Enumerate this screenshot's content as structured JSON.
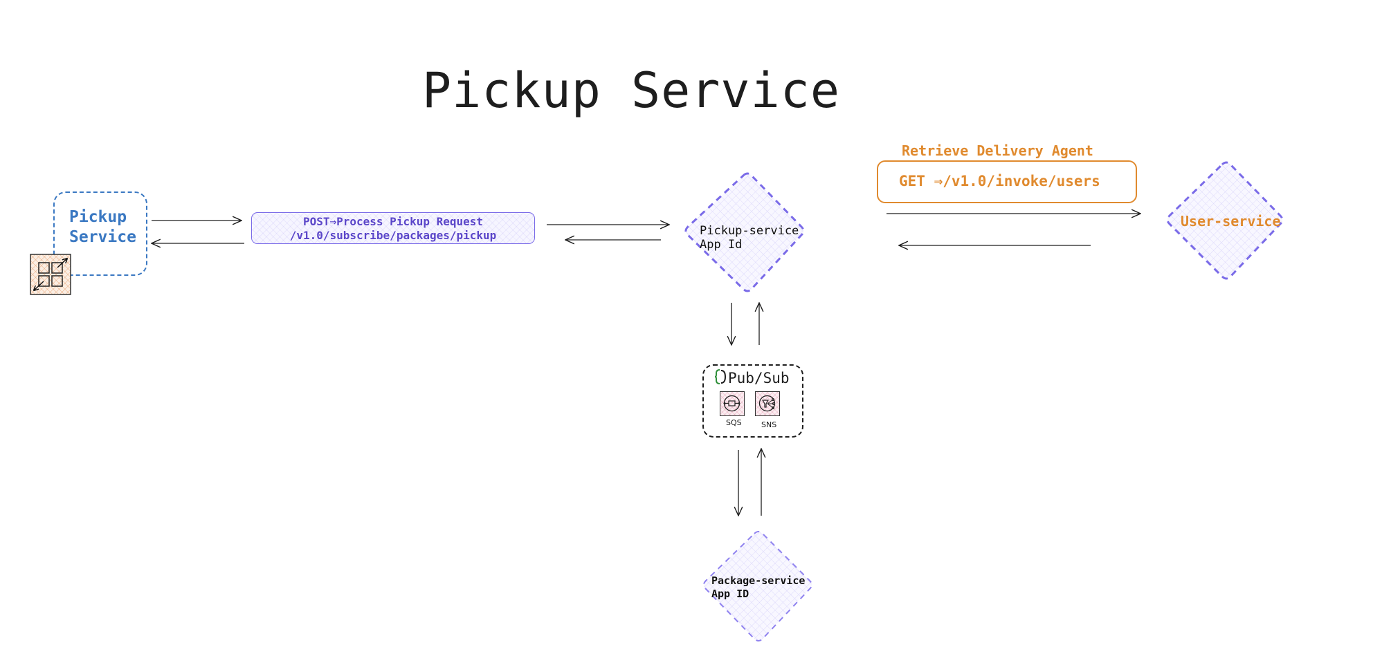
{
  "title": "Pickup Service",
  "nodes": {
    "pickup_client": {
      "line1": "Pickup",
      "line2": "Service",
      "color": "#3a78c2"
    },
    "pickup_service": {
      "line1": "Pickup-service",
      "line2": "App Id"
    },
    "user_service": {
      "label": "User-service",
      "color": "#e08a2e"
    },
    "package_service": {
      "line1": "Package-service",
      "line2": "App ID"
    },
    "pubsub": {
      "label": "Pub/Sub",
      "brace": "{}",
      "sqs_label": "SQS",
      "sns_label": "SNS"
    }
  },
  "edges": {
    "post_request": {
      "line1": "POST⇒Process Pickup Request",
      "line2": "/v1.0/subscribe/packages/pickup",
      "color": "#5b46c9"
    },
    "get_users": {
      "caption": "Retrieve Delivery Agent",
      "label": "GET ⇒/v1.0/invoke/users",
      "color": "#e08a2e"
    }
  },
  "icons": {
    "scaling": "scaling-icon",
    "sqs": "sqs-queue-icon",
    "sns": "sns-topic-icon"
  },
  "colors": {
    "diamond_stroke": "#7a6be8",
    "arrow": "#1e1e1e"
  }
}
